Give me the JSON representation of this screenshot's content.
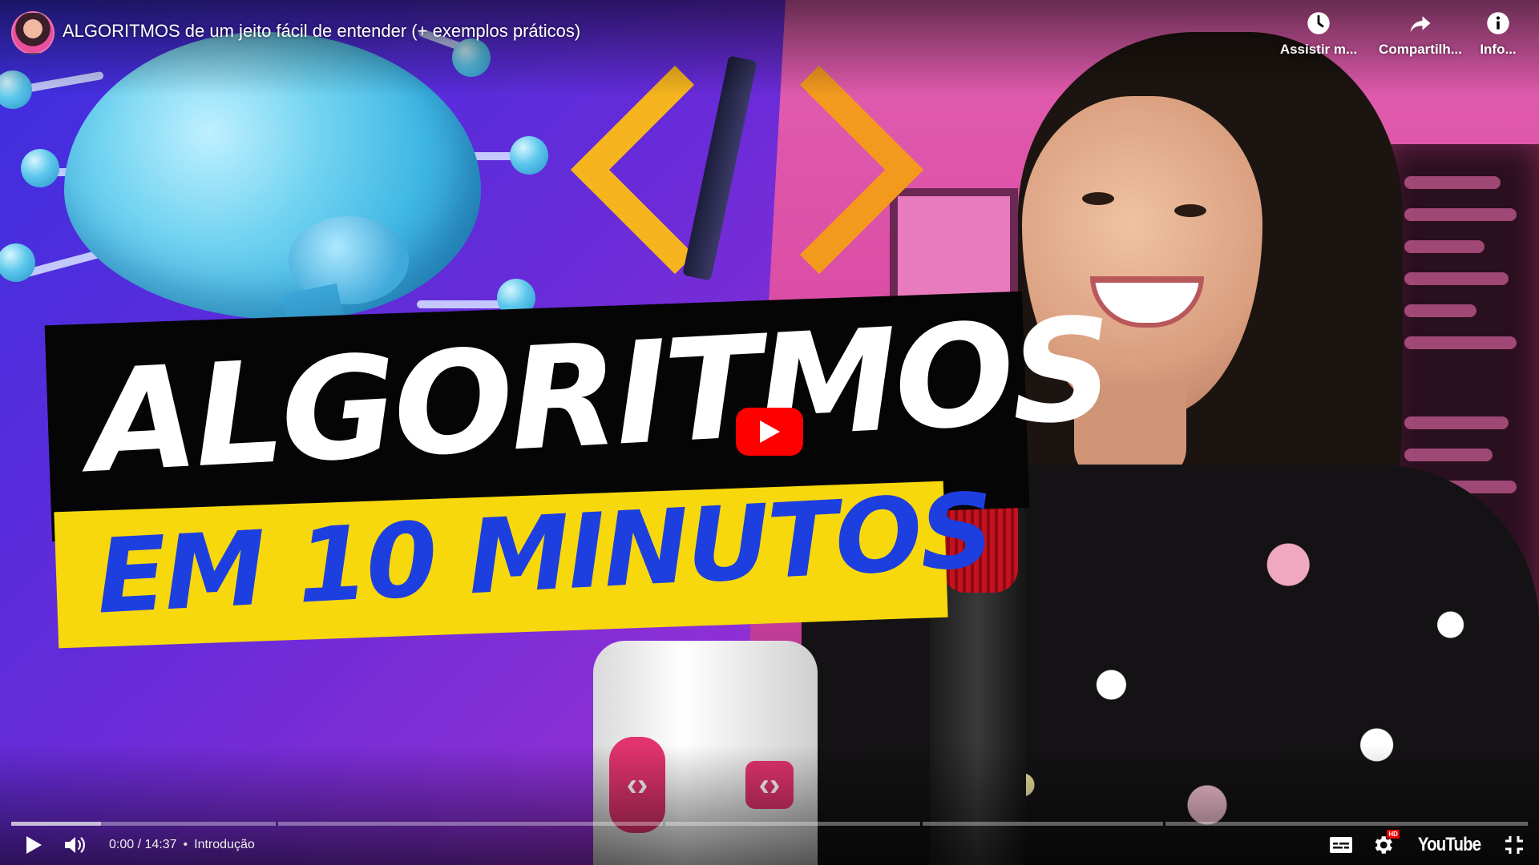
{
  "player": {
    "video_title": "ALGORITMOS de um jeito fácil de entender (+ exemplos práticos)",
    "top_actions": [
      {
        "icon": "clock-icon",
        "label": "Assistir m..."
      },
      {
        "icon": "share-icon",
        "label": "Compartilh..."
      },
      {
        "icon": "info-icon",
        "label": "Info..."
      }
    ],
    "time_current": "0:00",
    "time_separator": " / ",
    "time_total": "14:37",
    "chapter_separator": "•",
    "chapter_label": "Introdução",
    "brand_label": "YouTube",
    "hd_label": "HD",
    "progress_fraction": 0.0
  },
  "thumbnail": {
    "headline": "ALGORITMOS",
    "subheadline": "EM 10 MINUTOS"
  },
  "colors": {
    "play_red": "#ff0000",
    "banner_yellow": "#f7d80d",
    "subheadline_blue": "#1d3fe0"
  }
}
